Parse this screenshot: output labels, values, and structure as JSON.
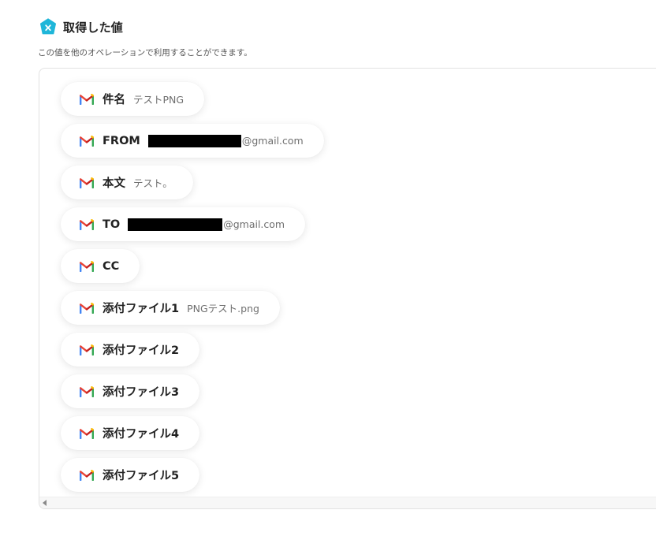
{
  "header": {
    "title": "取得した値",
    "icon": "hexagon-x-icon",
    "icon_color": "#1fb6d9"
  },
  "subtitle": "この値を他のオペレーションで利用することができます。",
  "fields": [
    {
      "label": "件名",
      "value": "テストPNG"
    },
    {
      "label": "FROM",
      "value": "@gmail.com",
      "redacted": true
    },
    {
      "label": "本文",
      "value": "テスト。"
    },
    {
      "label": "TO",
      "value": "@gmail.com",
      "redacted": true
    },
    {
      "label": "CC",
      "value": ""
    },
    {
      "label": "添付ファイル1",
      "value": "PNGテスト.png"
    },
    {
      "label": "添付ファイル2",
      "value": ""
    },
    {
      "label": "添付ファイル3",
      "value": ""
    },
    {
      "label": "添付ファイル4",
      "value": ""
    },
    {
      "label": "添付ファイル5",
      "value": ""
    }
  ],
  "field_icon": "gmail-icon"
}
